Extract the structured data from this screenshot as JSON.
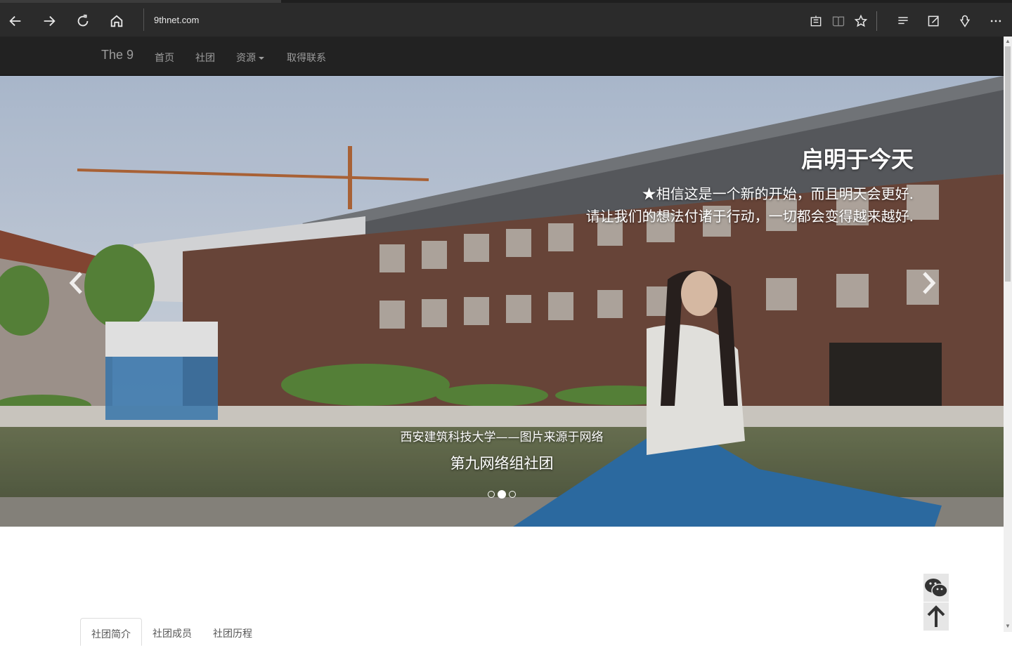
{
  "browser": {
    "url": "9thnet.com"
  },
  "navbar": {
    "brand": "The 9",
    "links": [
      "首页",
      "社团",
      "资源",
      "取得联系"
    ]
  },
  "carousel": {
    "headline": "启明于今天",
    "subline_1": "★相信这是一个新的开始，而且明天会更好.",
    "subline_2": "请让我们的想法付诸于行动，一切都会变得越来越好.",
    "caption_sub": "西安建筑科技大学——图片来源于网络",
    "caption_main": "第九网络组社团",
    "slide_count": 3,
    "active_slide": 2
  },
  "tabs": [
    "社团简介",
    "社团成员",
    "社团历程"
  ],
  "colors": {
    "browser_bg": "#2b2b2b",
    "navbar_bg": "#222222",
    "nav_text": "#9d9d9d"
  }
}
